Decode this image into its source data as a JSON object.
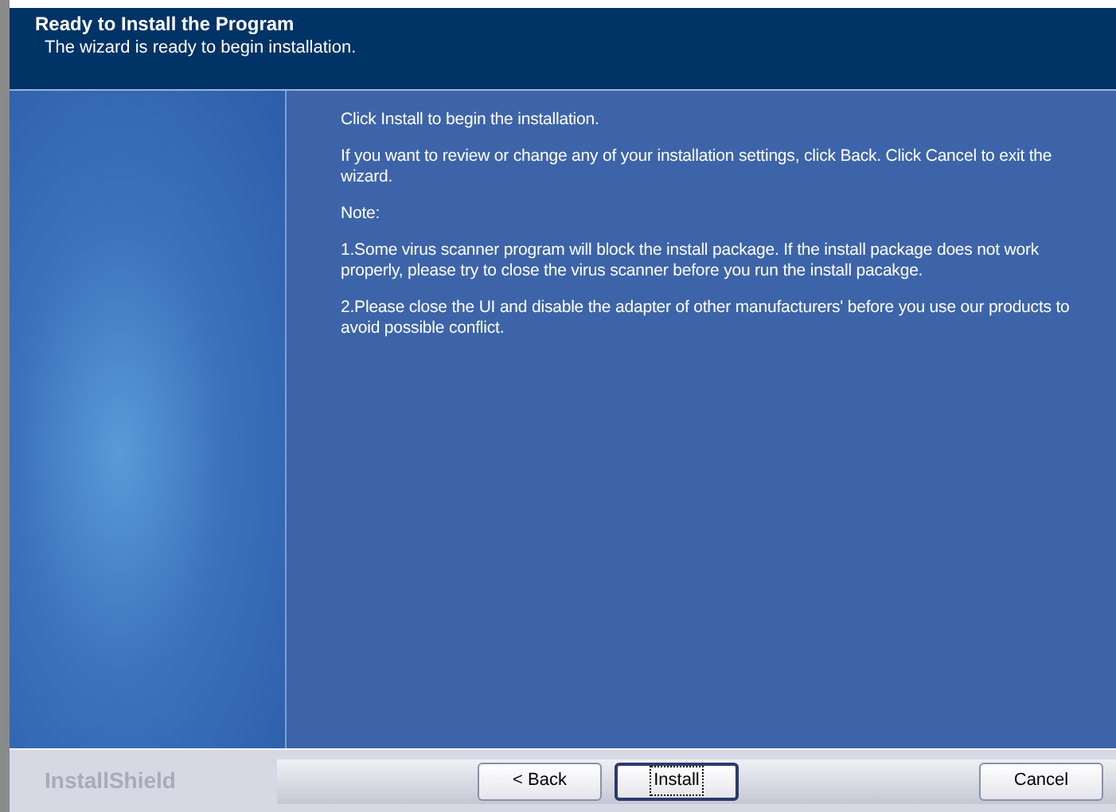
{
  "header": {
    "title": "Ready to Install the Program",
    "subtitle": "The wizard is ready to begin installation."
  },
  "body": {
    "paragraphs": [
      "Click Install to begin the installation.",
      "If you want to review or change any of your installation settings, click Back. Click Cancel to exit the wizard.",
      "Note:",
      "1.Some virus scanner program will block the install package. If the install package does not work properly, please try to close the virus scanner before you run the install pacakge.",
      "2.Please close the UI and disable the adapter of other manufacturers' before you use our products to avoid possible conflict."
    ]
  },
  "footer": {
    "brand": "InstallShield",
    "buttons": [
      {
        "label": "< Back",
        "focused": false
      },
      {
        "label": "Install",
        "focused": true
      },
      {
        "label": "Cancel",
        "focused": false
      }
    ]
  }
}
